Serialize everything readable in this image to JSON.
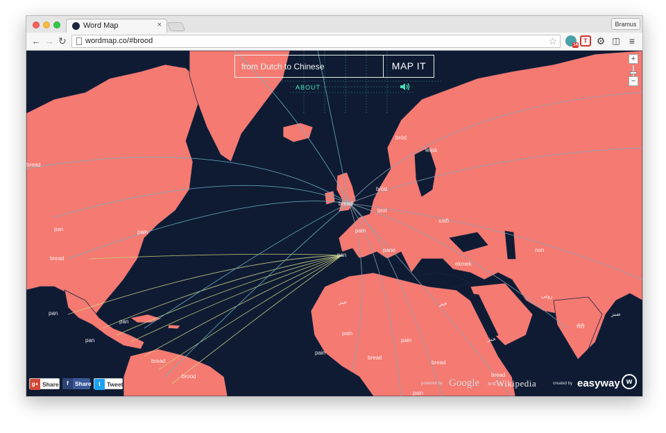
{
  "browser": {
    "tab_title": "Word Map",
    "tab_close": "×",
    "profile_name": "Bramus",
    "url": "wordmap.co/#brood",
    "nav": {
      "back": "←",
      "forward": "→",
      "reload": "↻"
    },
    "star": "☆",
    "extensions": [
      {
        "icon": "ghost-extension-icon",
        "badge": "14"
      },
      {
        "icon": "t-extension-icon",
        "label": "T"
      },
      {
        "icon": "gear-icon",
        "label": "⚙"
      },
      {
        "icon": "panels-icon",
        "label": "◫"
      },
      {
        "icon": "menu-icon",
        "label": "≡"
      }
    ]
  },
  "page": {
    "search": {
      "value": "from Dutch to Chinese",
      "button": "MAP IT"
    },
    "about": "ABOUT",
    "zoom": {
      "in": "+",
      "out": "−"
    },
    "share": [
      {
        "icon": "g+",
        "label": "Share"
      },
      {
        "icon": "f",
        "label": "Share"
      },
      {
        "icon": "t",
        "label": "Tweet"
      }
    ],
    "credits": {
      "powered_by": "powered by",
      "google": "Google",
      "and": "and",
      "wikipedia": "Wikipedia",
      "created_by": "created by",
      "easyway": "easyway",
      "logo": "w"
    },
    "colors": {
      "ocean": "#0e1b33",
      "land": "#f47a72",
      "border": "#1a2340",
      "accent": "#4ce0b8"
    },
    "word_labels": [
      "bread",
      "bread",
      "pain",
      "bread",
      "pan",
      "pan",
      "pan",
      "pan",
      "brood",
      "bröd",
      "leipä",
      "bröd",
      "bread",
      "brot",
      "pain",
      "хліб",
      "pane",
      "ekmek",
      "pan",
      "non",
      "روتی",
      "خبز",
      "خبز",
      "خبز",
      "pain",
      "pain",
      "bread",
      "bread",
      "pain",
      "bread",
      "रोटी",
      "ضبز",
      "pain"
    ]
  }
}
